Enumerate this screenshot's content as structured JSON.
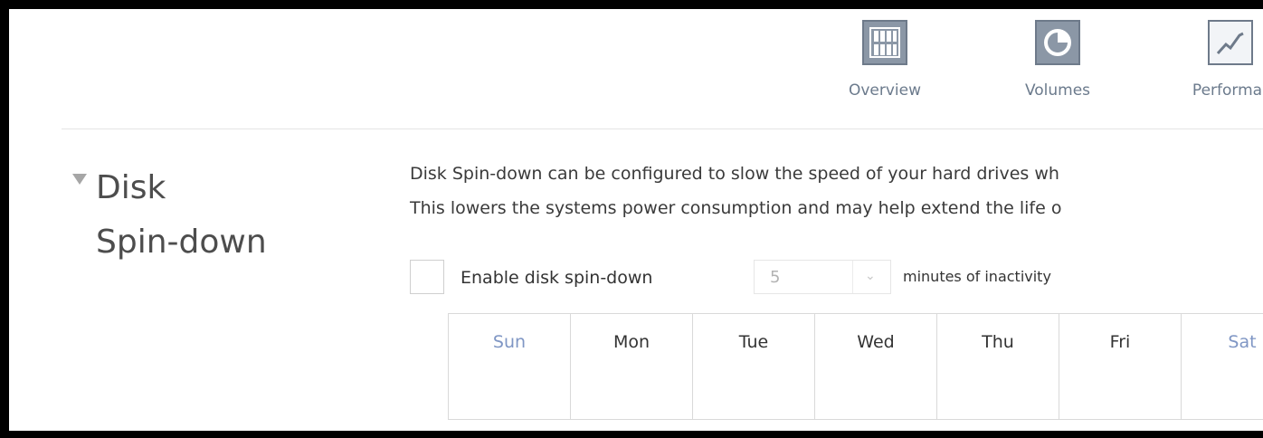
{
  "nav": {
    "items": [
      {
        "label": "Overview",
        "icon": "overview-icon"
      },
      {
        "label": "Volumes",
        "icon": "volumes-icon"
      },
      {
        "label": "Performar",
        "icon": "performance-icon"
      }
    ]
  },
  "section": {
    "title_line1": "Disk",
    "title_line2": "Spin-down",
    "description_line1": "Disk Spin-down can be configured to slow the speed of your hard drives wh",
    "description_line2": "This lowers the systems power consumption and may help extend the life o"
  },
  "spin_down": {
    "checkbox_label": "Enable disk spin-down",
    "checked": false,
    "minutes_value": "5",
    "minutes_suffix": "minutes of inactivity"
  },
  "schedule": {
    "days": [
      "Sun",
      "Mon",
      "Tue",
      "Wed",
      "Thu",
      "Fri",
      "Sat"
    ],
    "weekend_color": "#7f96c4"
  },
  "colors": {
    "nav_icon": "#8b97a6",
    "nav_label": "#6b7a8c"
  }
}
